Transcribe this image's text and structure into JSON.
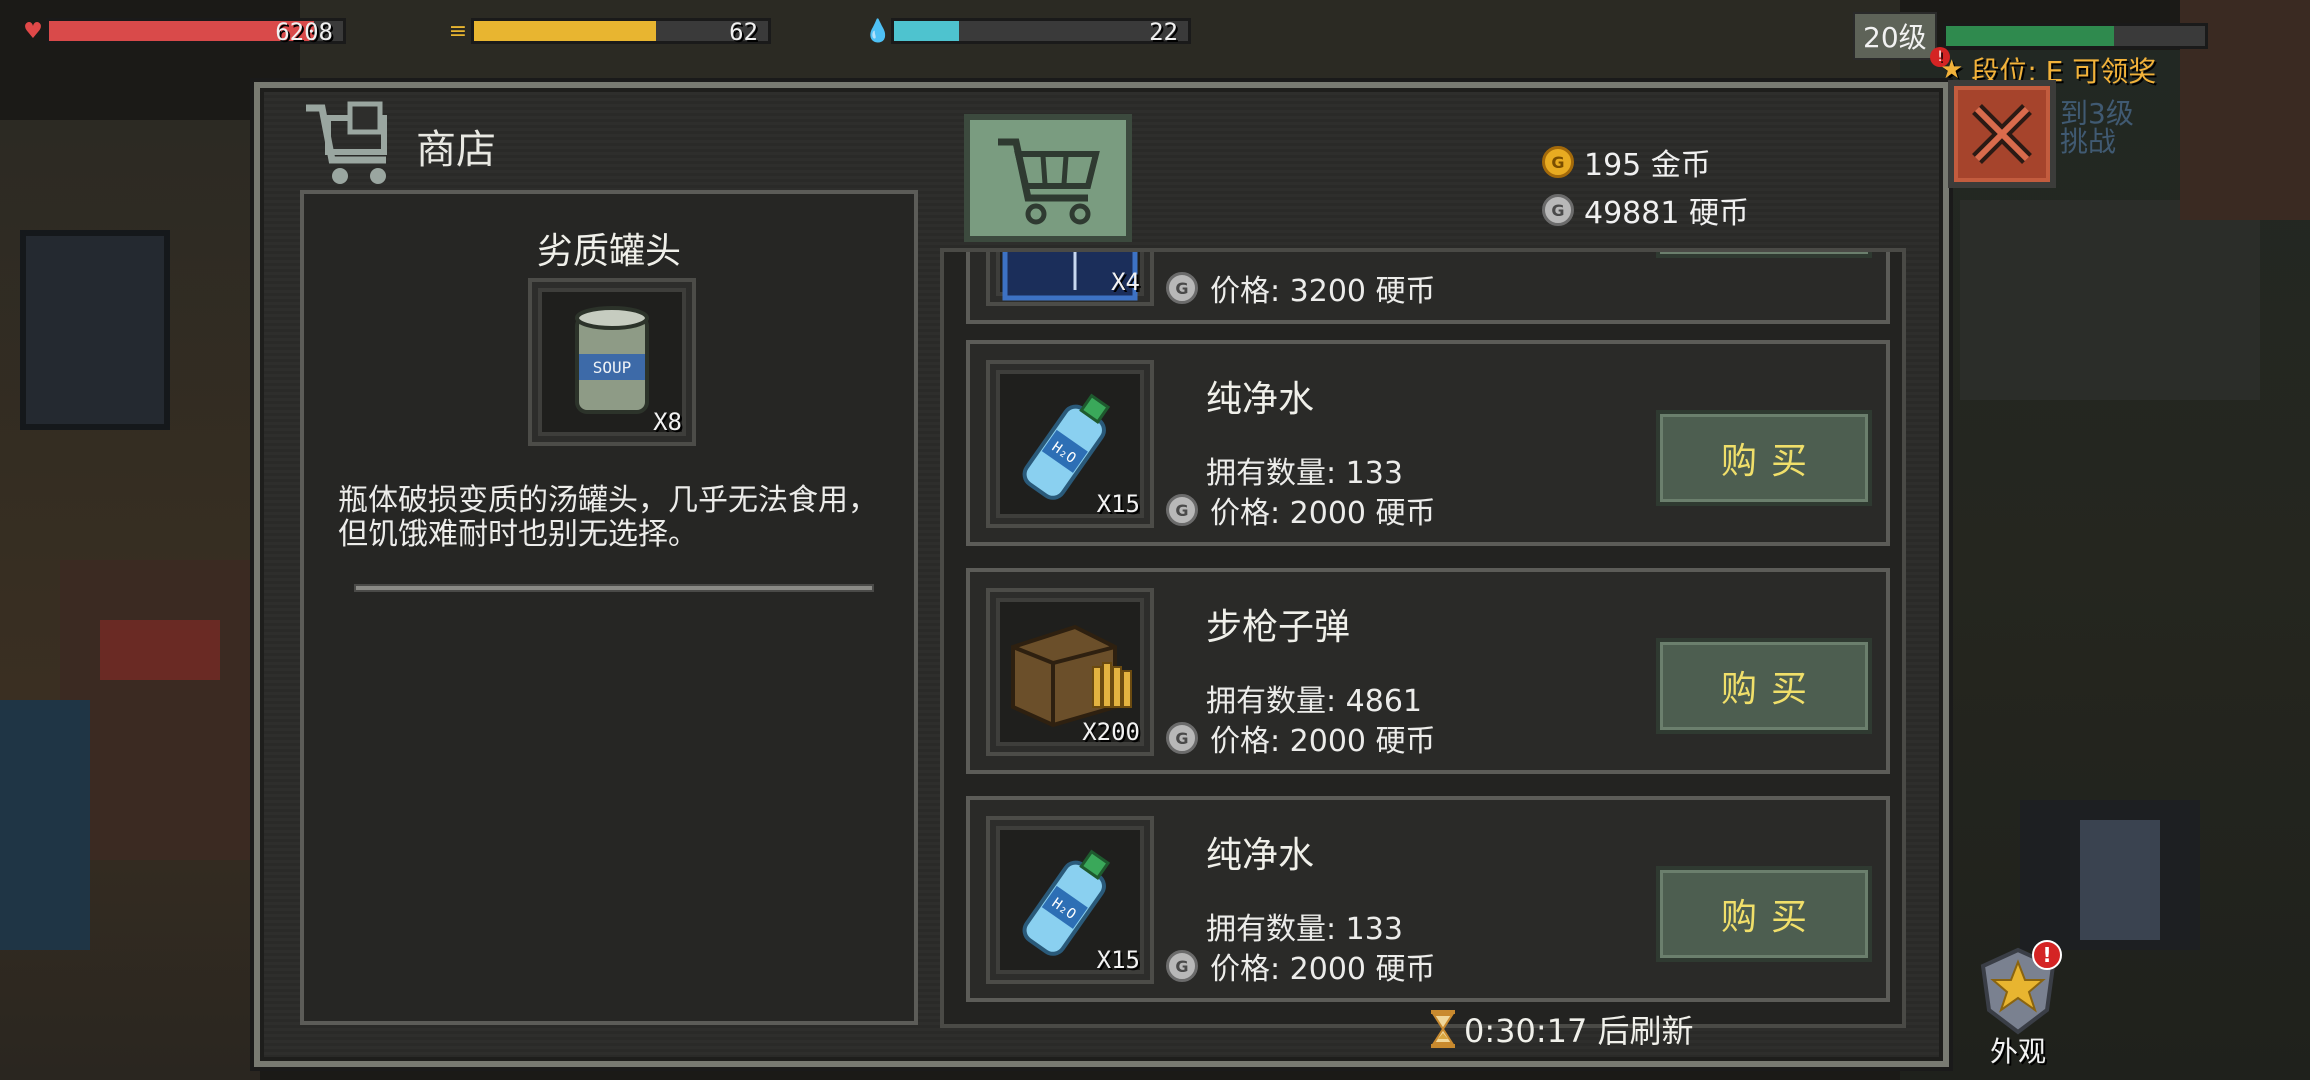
{
  "hud": {
    "hp": {
      "value": "6208",
      "fill": 0.9
    },
    "food": {
      "value": "62",
      "fill": 0.62
    },
    "water": {
      "value": "22",
      "fill": 0.22
    },
    "level": {
      "label": "20级",
      "fill": 0.65
    },
    "rank": "段位: E 可领奖",
    "rank_badge": "!",
    "faint_1": "到3级",
    "faint_2": "挑战"
  },
  "shop": {
    "title": "商店",
    "gold": "195 金币",
    "coins": "49881 硬币",
    "detail": {
      "name": "劣质罐头",
      "qty": "X8",
      "icon_label": "SOUP",
      "description": "瓶体破损变质的汤罐头，几乎无法食用，但饥饿难耐时也别无选择。"
    },
    "items": [
      {
        "name": "",
        "own": "",
        "price": "价格: 3200 硬币",
        "qty": "X4",
        "icon": "blue-item-icon",
        "buy": ""
      },
      {
        "name": "纯净水",
        "own": "拥有数量: 133",
        "price": "价格: 2000 硬币",
        "qty": "X15",
        "icon": "water-bottle-icon",
        "buy": "购买"
      },
      {
        "name": "步枪子弹",
        "own": "拥有数量: 4861",
        "price": "价格: 2000 硬币",
        "qty": "X200",
        "icon": "rifle-ammo-icon",
        "buy": "购买"
      },
      {
        "name": "纯净水",
        "own": "拥有数量: 133",
        "price": "价格: 2000 硬币",
        "qty": "X15",
        "icon": "water-bottle-icon",
        "buy": "购买"
      }
    ],
    "refresh": "0:30:17 后刷新"
  },
  "skin_button": {
    "label": "外观",
    "badge": "!"
  },
  "colors": {
    "hp": "#d94a4a",
    "food": "#e8b530",
    "water": "#4ec3cf",
    "xp": "#2f8a4e",
    "buy_text": "#f0df6a",
    "close": "#a6442c"
  }
}
